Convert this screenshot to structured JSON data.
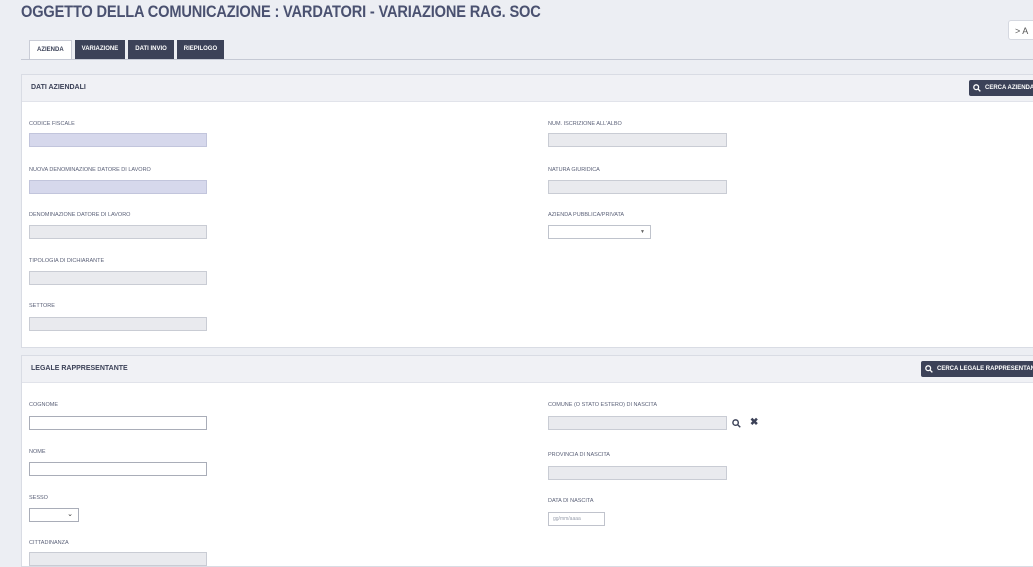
{
  "page": {
    "title": "OGGETTO DELLA COMUNICAZIONE : VARDATORI - VARIAZIONE RAG. SOC",
    "collapse_label": "> A"
  },
  "tabs": [
    {
      "label": "AZIENDA",
      "active": true
    },
    {
      "label": "VARIAZIONE",
      "active": false
    },
    {
      "label": "DATI INVIO",
      "active": false
    },
    {
      "label": "RIEPILOGO",
      "active": false
    }
  ],
  "dati_aziendali": {
    "title": "DATI AZIENDALI",
    "search_button": "CERCA AZIENDA",
    "fields": {
      "codice_fiscale": "CODICE FISCALE",
      "nuova_denominazione": "NUOVA DENOMINAZIONE DATORE DI LAVORO",
      "denominazione": "DENOMINAZIONE DATORE DI LAVORO",
      "tipologia": "TIPOLOGIA DI DICHIARANTE",
      "settore": "SETTORE",
      "num_iscrizione": "NUM. ISCRIZIONE ALL'ALBO",
      "natura_giuridica": "NATURA GIURIDICA",
      "azienda_pubblica": "AZIENDA PUBBLICA/PRIVATA"
    }
  },
  "legale_rappresentante": {
    "title": "LEGALE RAPPRESENTANTE",
    "search_button": "CERCA LEGALE RAPPRESENTANTE",
    "fields": {
      "cognome": "COGNOME",
      "nome": "NOME",
      "sesso": "SESSO",
      "cittadinanza": "CITTADINANZA",
      "comune_nascita": "COMUNE (O STATO ESTERO) DI NASCITA",
      "provincia_nascita": "PROVINCIA DI NASCITA",
      "data_nascita": "DATA DI NASCITA",
      "data_placeholder": "gg/mm/aaaa"
    }
  },
  "icons": {
    "search": "search-icon",
    "clear": "close-icon",
    "dropdown": "chevron-down-icon"
  }
}
